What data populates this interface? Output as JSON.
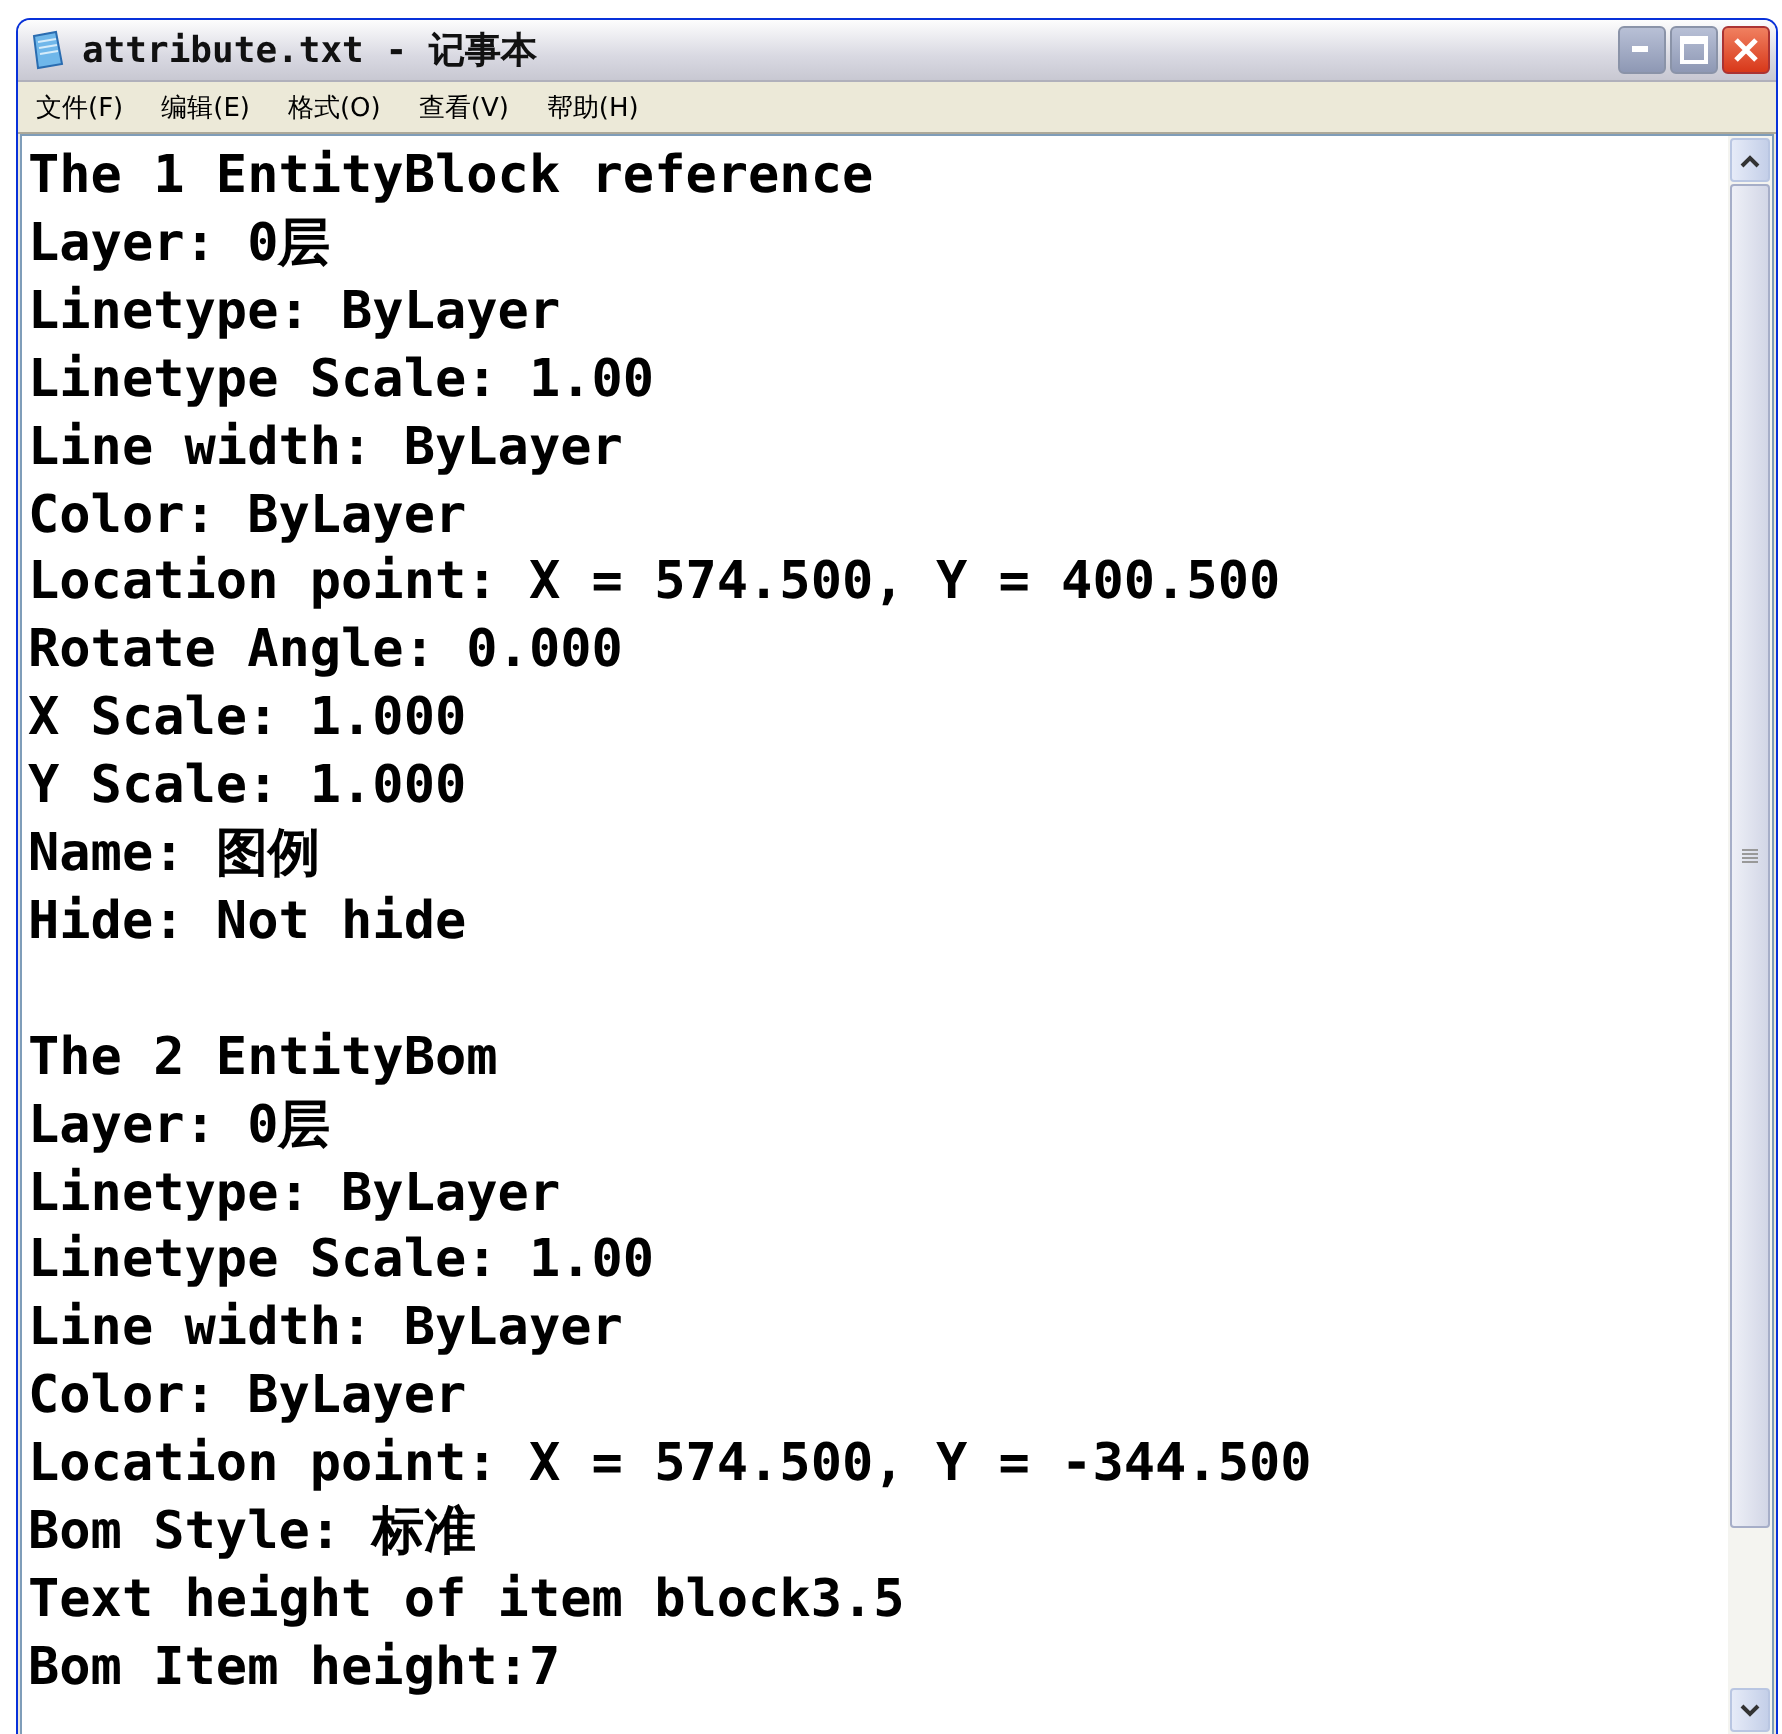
{
  "window": {
    "title": "attribute.txt - 记事本"
  },
  "menu": [
    "文件(F)",
    "编辑(E)",
    "格式(O)",
    "查看(V)",
    "帮助(H)"
  ],
  "document": {
    "blocks": [
      {
        "lines": [
          "The 1 EntityBlock reference",
          "Layer: 0层",
          "Linetype: ByLayer",
          "Linetype Scale: 1.00",
          "Line width: ByLayer",
          "Color: ByLayer",
          "Location point: X = 574.500, Y = 400.500",
          "Rotate Angle: 0.000",
          "X Scale: 1.000",
          "Y Scale: 1.000",
          "Name: 图例",
          "Hide: Not hide"
        ]
      },
      {
        "lines": [
          "The 2 EntityBom",
          "Layer: 0层",
          "Linetype: ByLayer",
          "Linetype Scale: 1.00",
          "Line width: ByLayer",
          "Color: ByLayer",
          "Location point: X = 574.500, Y = -344.500",
          "Bom Style: 标准",
          "Text height of item block3.5",
          "Bom Item height:7"
        ]
      }
    ]
  }
}
